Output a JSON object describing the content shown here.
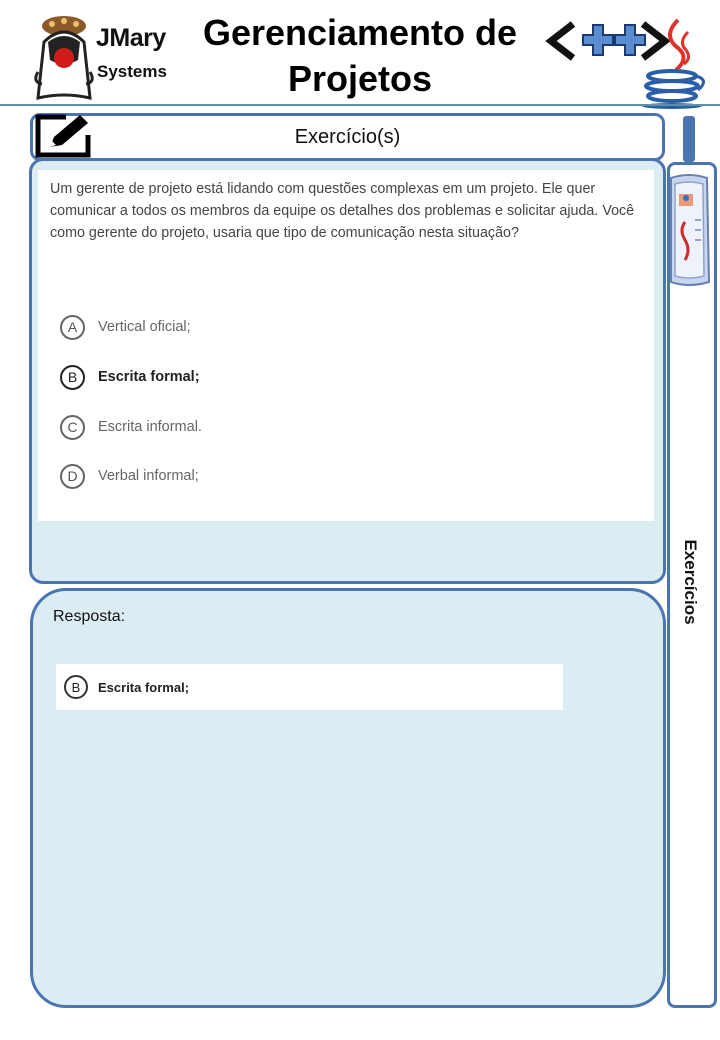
{
  "header": {
    "brand_line1": "JMary",
    "brand_line2": "Systems",
    "title": "Gerenciamento de Projetos",
    "brand_mark": "<++>"
  },
  "exercise": {
    "title": "Exercício(s)",
    "question": "Um gerente de projeto está lidando com questões complexas em um projeto. Ele quer comunicar a todos os membros da equipe os detalhes dos problemas e solicitar ajuda. Você como gerente do projeto, usaria que tipo de comunicação nesta situação?",
    "options": [
      {
        "letter": "A",
        "text": "Vertical oficial;"
      },
      {
        "letter": "B",
        "text": "Escrita formal;"
      },
      {
        "letter": "C",
        "text": "Escrita informal."
      },
      {
        "letter": "D",
        "text": "Verbal informal;"
      }
    ],
    "selected_option": "B"
  },
  "answer": {
    "label": "Resposta:",
    "letter": "B",
    "text": "Escrita formal;"
  },
  "sidebar": {
    "label": "Exercícios",
    "icon": "newspaper-icon"
  },
  "icons": [
    "pencil-edit-icon",
    "java-cup-icon",
    "duke-mascot-logo"
  ],
  "colors": {
    "panel_border": "#4a75b0",
    "panel_fill": "#dbedf3",
    "header_rule": "#5f8fa9",
    "plus_fill": "#5b8bd0"
  }
}
